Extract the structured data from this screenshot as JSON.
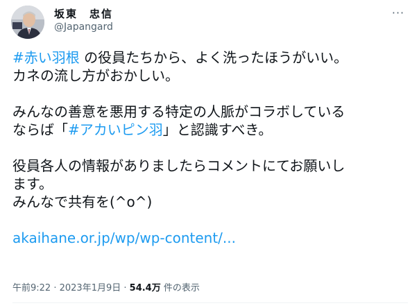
{
  "author": {
    "name": "坂東　忠信",
    "handle": "@Japangard"
  },
  "menu": {
    "icon": "more-horizontal-icon",
    "glyph": "···"
  },
  "tweet": {
    "line1": {
      "hashtag": "#赤い羽根",
      "text": " の役員たちから、よく洗ったほうがいい。"
    },
    "line2": "カネの流し方がおかしい。",
    "line3": "みんなの善意を悪用する特定の人脈がコラボしている",
    "line4": {
      "before": "ならば「",
      "hashtag": "#アカいピン羽",
      "after": "」と認識すべき。"
    },
    "line5": "役員各人の情報がありましたらコメントにてお願いし",
    "line6": "ます。",
    "line7": "みんなで共有を(^o^)",
    "link": "akaihane.or.jp/wp/wp-content/..."
  },
  "meta": {
    "time": "午前9:22",
    "separator1": " · ",
    "date": "2023年1月9日",
    "separator2": " · ",
    "views_count": "54.4万",
    "views_label": " 件の表示"
  },
  "colors": {
    "link": "#1d9bf0",
    "text": "#0f1419",
    "secondary": "#536471"
  }
}
